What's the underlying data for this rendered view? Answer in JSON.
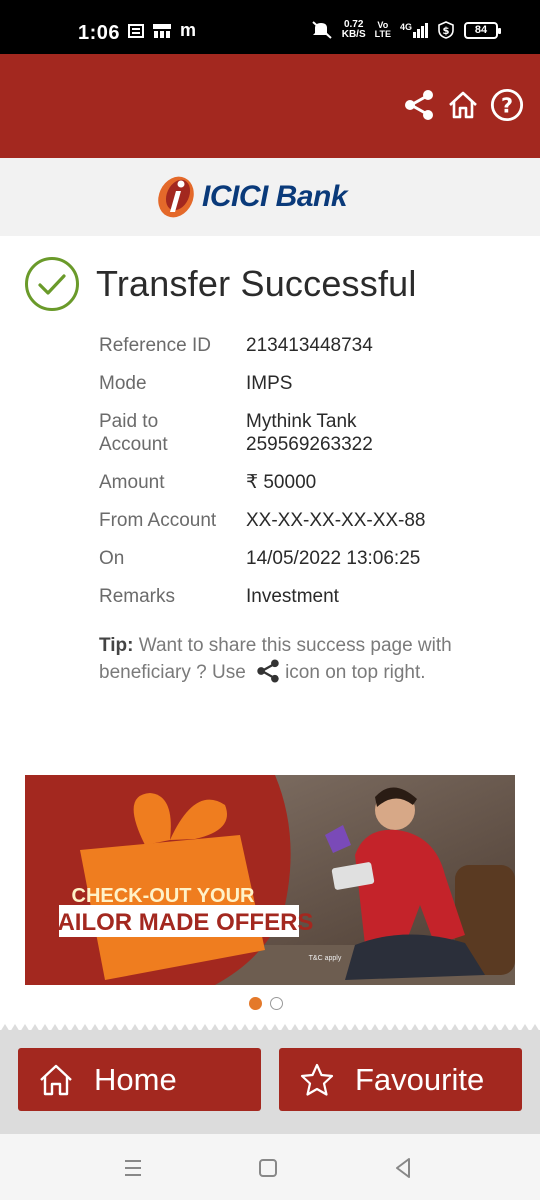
{
  "status_bar": {
    "time": "1:06",
    "left_icons": [
      "notification-icon",
      "store-icon",
      "m-icon"
    ],
    "m_label": "m",
    "speed_value": "0.72",
    "speed_unit": "KB/S",
    "volte_top": "Vo",
    "volte_bottom": "LTE",
    "network": "4G",
    "battery": "84"
  },
  "header": {
    "icons": [
      "share-icon",
      "home-icon",
      "help-icon"
    ],
    "color": "#a3281f"
  },
  "logo": {
    "text": "ICICI Bank",
    "brand_colors": [
      "#0a3a7a",
      "#e4692a",
      "#a3281f"
    ]
  },
  "success": {
    "title": "Transfer Successful",
    "icon": "check-circle-icon",
    "icon_color": "#6a9a2a"
  },
  "details": [
    {
      "label": "Reference ID",
      "value": "213413448734"
    },
    {
      "label": "Mode",
      "value": "IMPS"
    },
    {
      "label": "Paid to Account",
      "value": "Mythink Tank 259569263322"
    },
    {
      "label": "Amount",
      "value": "₹ 50000"
    },
    {
      "label": "From Account",
      "value": "XX-XX-XX-XX-XX-88"
    },
    {
      "label": "On",
      "value": "14/05/2022 13:06:25"
    },
    {
      "label": "Remarks",
      "value": "Investment"
    }
  ],
  "details_paid_to": {
    "label_line1": "Paid to",
    "label_line2": "Account",
    "value_line1": "Mythink Tank",
    "value_line2": "259569263322"
  },
  "tip": {
    "label": "Tip:",
    "text_before": " Want to share this success page with beneficiary ? Use",
    "text_after": "icon on top right."
  },
  "banner": {
    "line1": "CHECK-OUT YOUR",
    "line2": "TAILOR MADE OFFERS",
    "small": "T&C apply",
    "slides": 2,
    "active_slide": 1
  },
  "actions": {
    "home_label": "Home",
    "favourite_label": "Favourite"
  },
  "navbar": {
    "icons": [
      "menu-icon",
      "square-icon",
      "back-icon"
    ]
  }
}
